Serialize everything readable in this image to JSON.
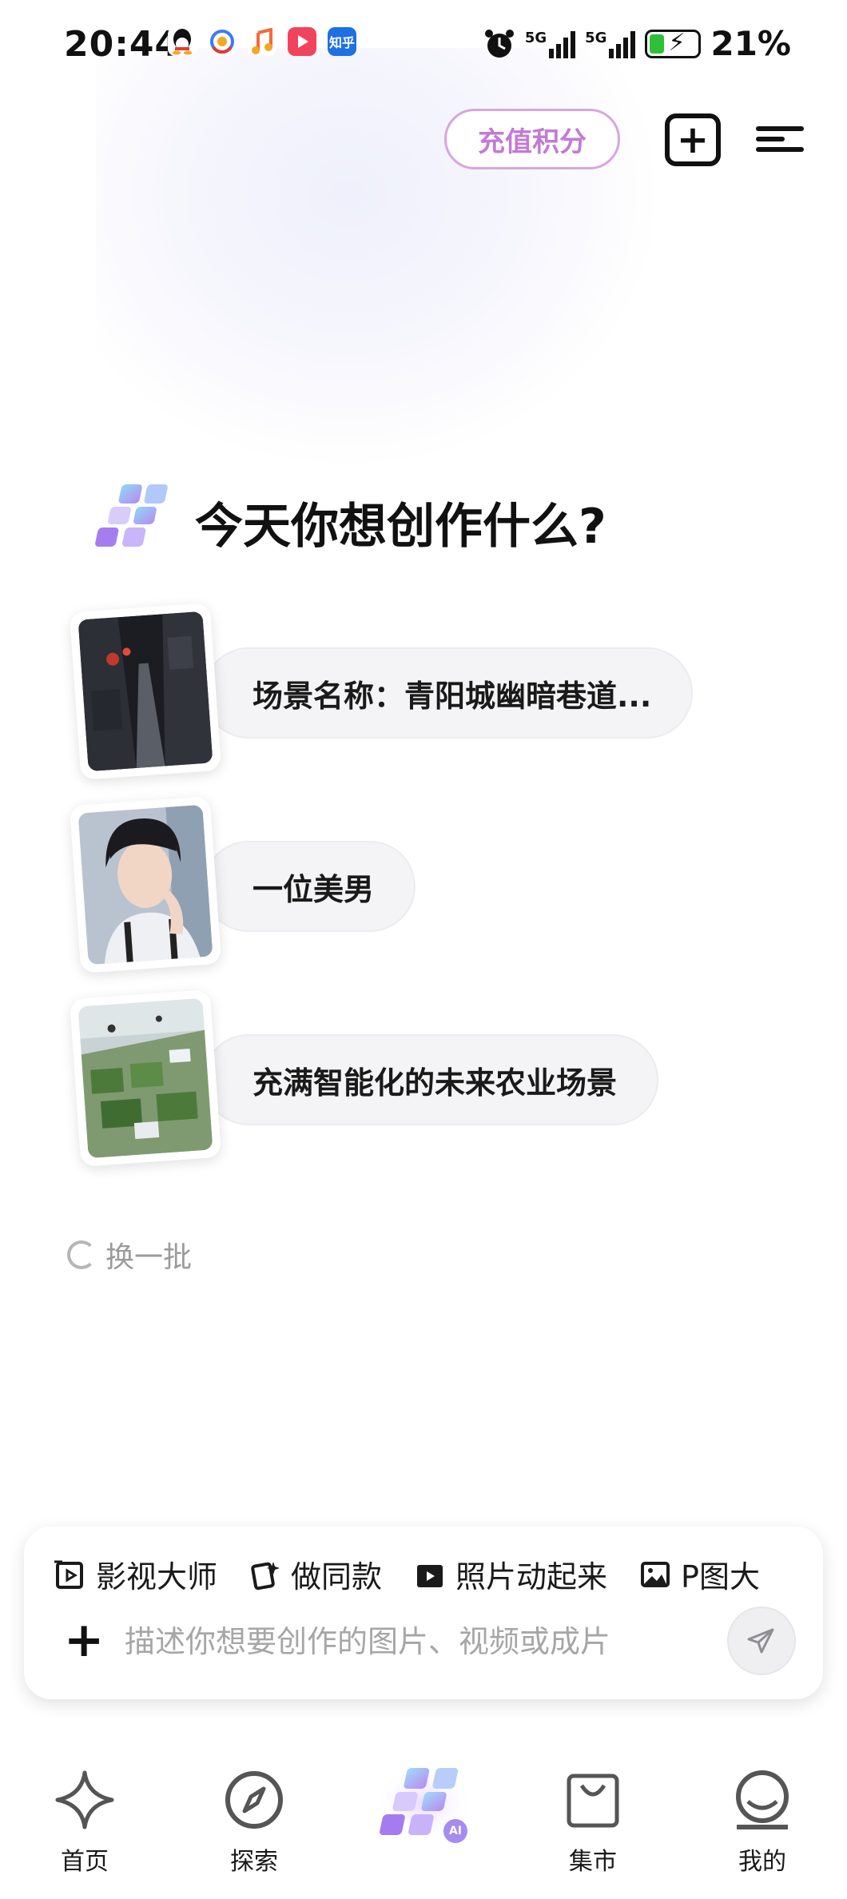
{
  "status_bar": {
    "time": "20:44",
    "app_icons": [
      "qq-icon",
      "browser-icon",
      "music-icon",
      "video-icon",
      "zhihu-icon"
    ],
    "zhihu_label": "知乎",
    "signal_1": "5G",
    "signal_2": "5G",
    "battery": "21%"
  },
  "header": {
    "recharge_label": "充值积分"
  },
  "main": {
    "headline": "今天你想创作什么?",
    "suggestions": [
      {
        "label": "场景名称：青阳城幽暗巷道..."
      },
      {
        "label": "一位美男"
      },
      {
        "label": "充满智能化的未来农业场景"
      }
    ],
    "refresh_label": "换一批"
  },
  "composer": {
    "chips": [
      {
        "label": "影视大师",
        "icon": "film-frame-icon"
      },
      {
        "label": "做同款",
        "icon": "copy-style-icon"
      },
      {
        "label": "照片动起来",
        "icon": "clapper-icon"
      },
      {
        "label": "P图大",
        "icon": "image-edit-icon"
      }
    ],
    "placeholder": "描述你想要创作的图片、视频或成片"
  },
  "bottom_nav": [
    {
      "label": "首页",
      "icon": "sparkle-icon"
    },
    {
      "label": "探索",
      "icon": "compass-icon"
    },
    {
      "label": "",
      "icon": "ai-create-icon",
      "badge": "AI"
    },
    {
      "label": "集市",
      "icon": "shopping-bag-icon"
    },
    {
      "label": "我的",
      "icon": "profile-icon"
    }
  ],
  "colors": {
    "accent_pink": "#c37ad6",
    "accent_purple": "#9b8cf0"
  }
}
